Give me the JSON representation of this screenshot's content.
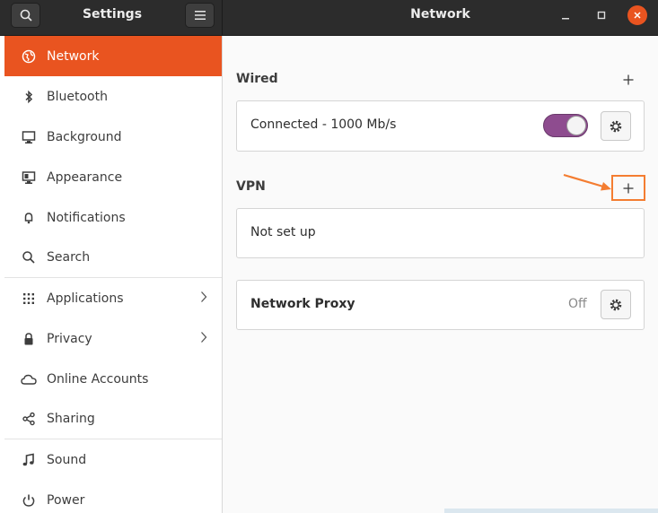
{
  "header": {
    "left_title": "Settings",
    "right_title": "Network"
  },
  "sidebar": {
    "items": [
      {
        "label": "Network",
        "icon": "globe-icon",
        "active": true
      },
      {
        "label": "Bluetooth",
        "icon": "bluetooth-icon"
      },
      {
        "label": "Background",
        "icon": "monitor-icon"
      },
      {
        "label": "Appearance",
        "icon": "appearance-icon"
      },
      {
        "label": "Notifications",
        "icon": "bell-icon"
      },
      {
        "label": "Search",
        "icon": "search-icon"
      },
      {
        "label": "Applications",
        "icon": "grid-icon",
        "has_submenu": true
      },
      {
        "label": "Privacy",
        "icon": "lock-icon",
        "has_submenu": true
      },
      {
        "label": "Online Accounts",
        "icon": "cloud-icon"
      },
      {
        "label": "Sharing",
        "icon": "share-icon"
      },
      {
        "label": "Sound",
        "icon": "music-note-icon"
      },
      {
        "label": "Power",
        "icon": "power-icon"
      }
    ]
  },
  "main": {
    "wired": {
      "title": "Wired",
      "connection_status": "Connected - 1000 Mb/s",
      "switch_on": true
    },
    "vpn": {
      "title": "VPN",
      "status": "Not set up"
    },
    "proxy": {
      "title": "Network Proxy",
      "state": "Off"
    }
  },
  "colors": {
    "accent": "#e95420",
    "annotation": "#f47d31",
    "switch_on": "#8e4c8f",
    "header_bg": "#2c2c2c"
  }
}
